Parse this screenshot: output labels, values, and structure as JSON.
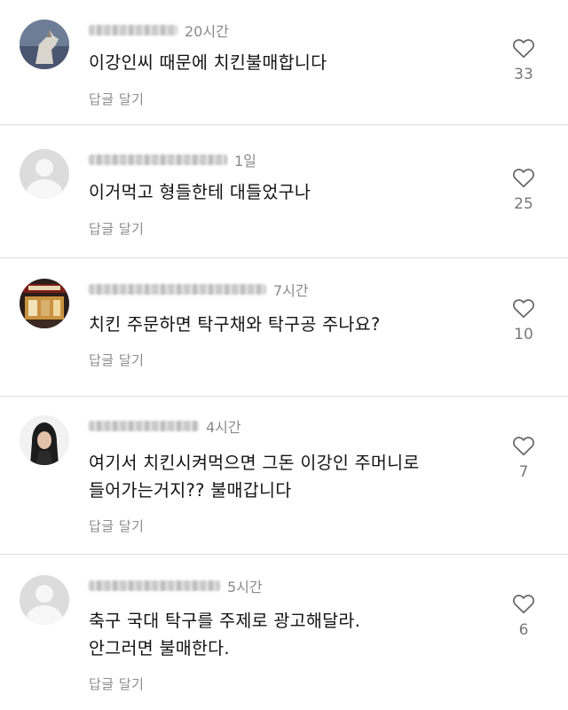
{
  "comments": [
    {
      "username": "",
      "time": "20시간",
      "text": "이강인씨 때문에 치킨불매합니다",
      "reply": "답글 달기",
      "likes": "33",
      "avatar_icon": "wolf-photo"
    },
    {
      "username": "",
      "time": "1일",
      "text": "이거먹고 형들한테 대들었구나",
      "reply": "답글 달기",
      "likes": "25",
      "avatar_icon": "default-user"
    },
    {
      "username": "",
      "time": "7시간",
      "text": "치킨 주문하면 탁구채와 탁구공 주나요?",
      "reply": "답글 달기",
      "likes": "10",
      "avatar_icon": "storefront-photo"
    },
    {
      "username": "",
      "time": "4시간",
      "text": "여기서 치킨시켜먹으면 그돈 이강인 주머니로\n들어가는거지?? 불매갑니다",
      "reply": "답글 달기",
      "likes": "7",
      "avatar_icon": "person-photo"
    },
    {
      "username": "",
      "time": "5시간",
      "text": "축구 국대 탁구를 주제로 광고해달라.\n안그러면 불매한다.",
      "reply": "답글 달기",
      "likes": "6",
      "avatar_icon": "default-user"
    }
  ]
}
